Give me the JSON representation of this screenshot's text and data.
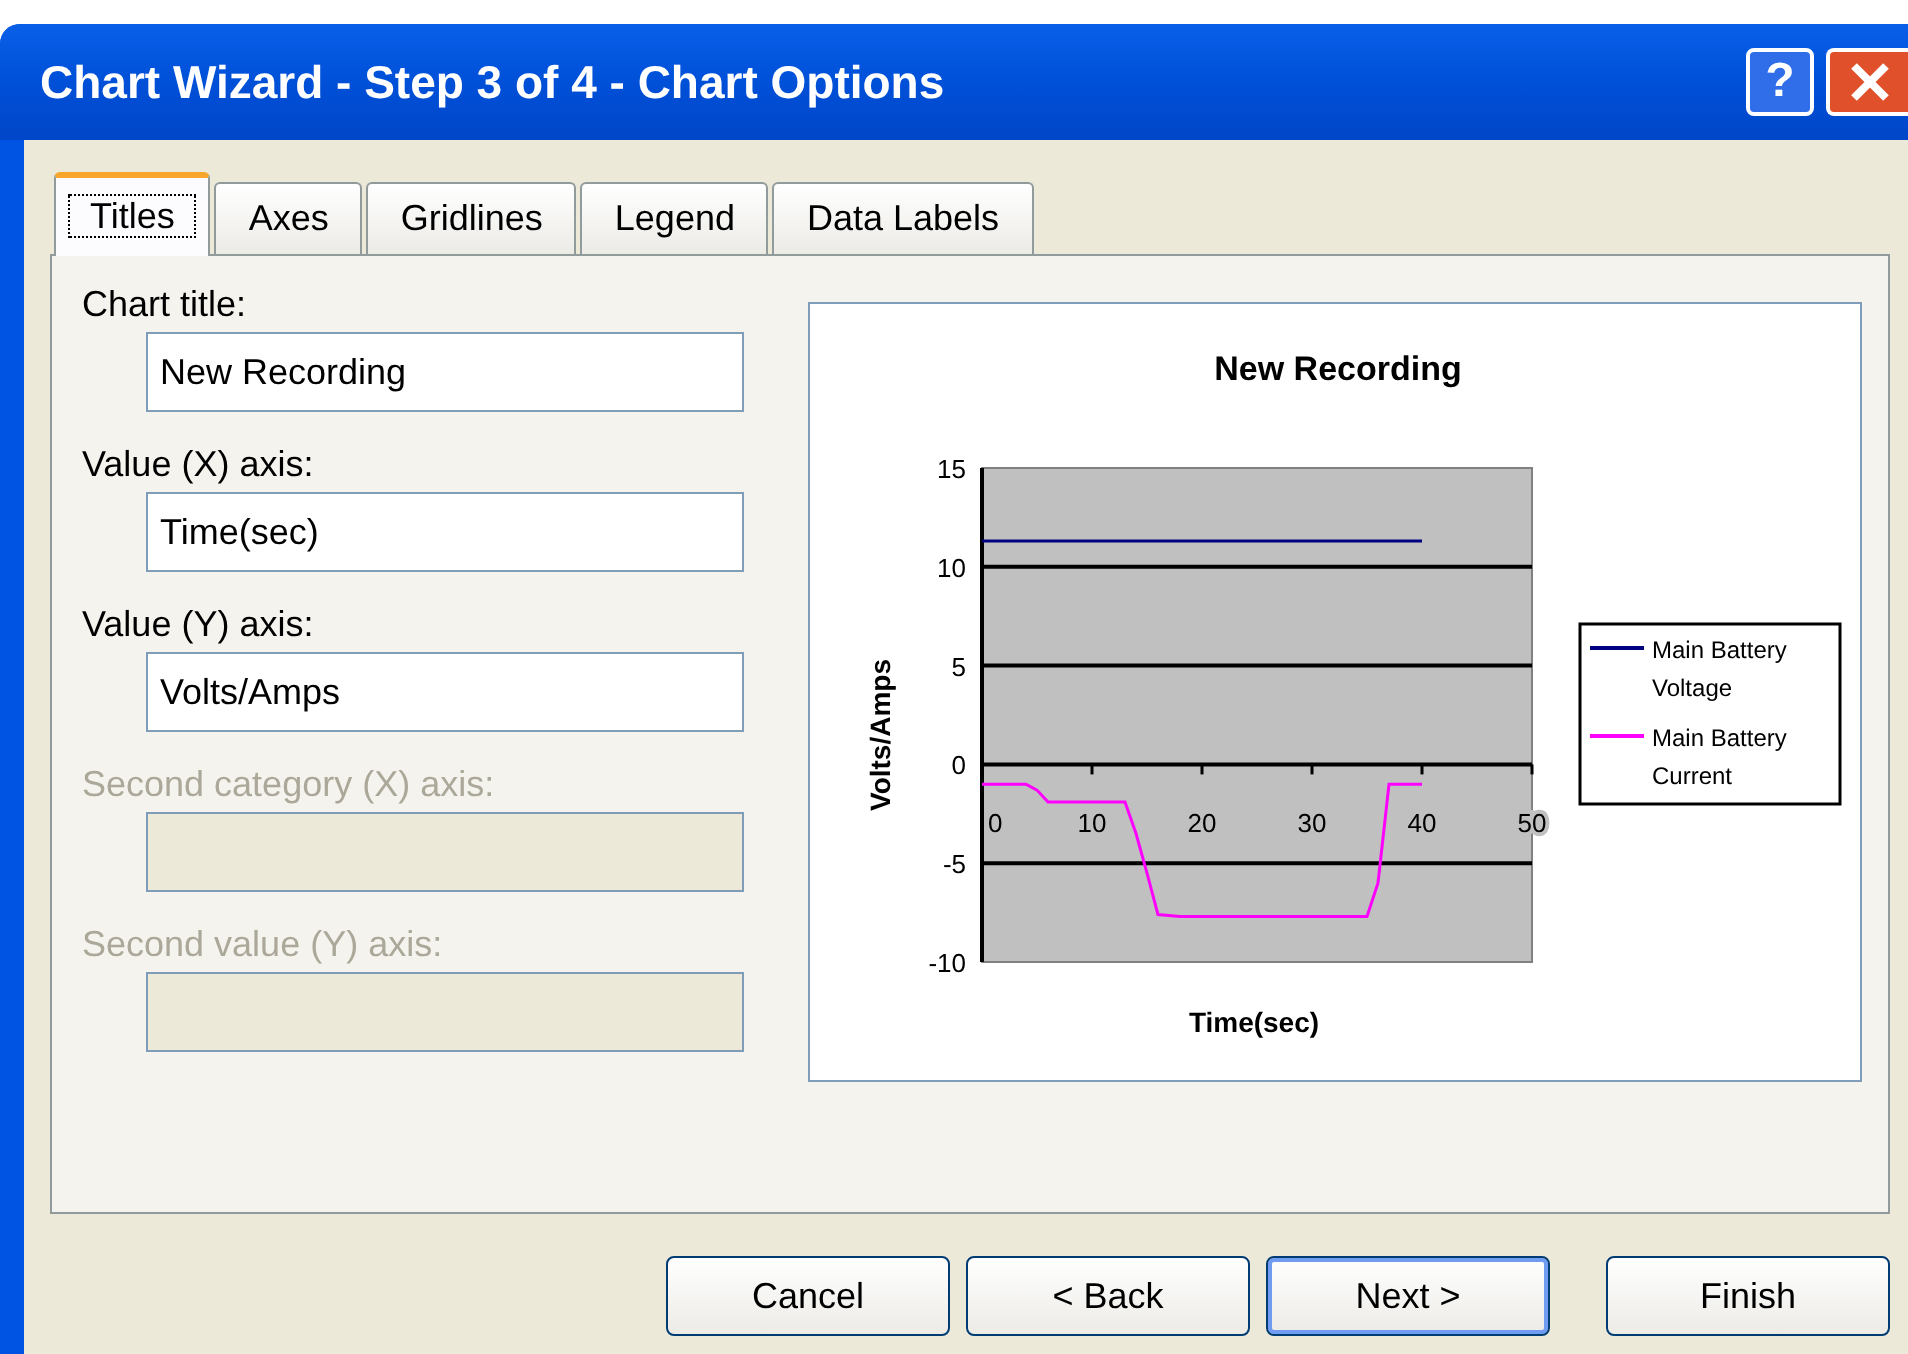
{
  "window": {
    "title": "Chart Wizard - Step 3 of 4 - Chart Options",
    "help_button": "?"
  },
  "tabs": [
    {
      "label": "Titles",
      "selected": true
    },
    {
      "label": "Axes",
      "selected": false
    },
    {
      "label": "Gridlines",
      "selected": false
    },
    {
      "label": "Legend",
      "selected": false
    },
    {
      "label": "Data Labels",
      "selected": false
    }
  ],
  "fields": [
    {
      "label": "Chart title:",
      "value": "New Recording",
      "disabled": false
    },
    {
      "label": "Value (X) axis:",
      "value": "Time(sec)",
      "disabled": false
    },
    {
      "label": "Value (Y) axis:",
      "value": "Volts/Amps",
      "disabled": false
    },
    {
      "label": "Second category (X) axis:",
      "disabled": true
    },
    {
      "label": "Second value (Y) axis:",
      "disabled": true
    }
  ],
  "preview": {
    "chart_data": {
      "type": "line",
      "title": "New Recording",
      "xlabel": "Time(sec)",
      "ylabel": "Volts/Amps",
      "x": [
        0,
        2,
        4,
        5,
        6,
        8,
        10,
        12,
        13,
        14,
        15,
        16,
        18,
        20,
        25,
        30,
        35,
        36,
        37,
        38,
        40
      ],
      "series": [
        {
          "name": "Main Battery Voltage",
          "color": "#000080",
          "values": [
            11.3,
            11.3,
            11.3,
            11.3,
            11.3,
            11.3,
            11.3,
            11.3,
            11.3,
            11.3,
            11.3,
            11.3,
            11.3,
            11.3,
            11.3,
            11.3,
            11.3,
            11.3,
            11.3,
            11.3,
            11.3
          ]
        },
        {
          "name": "Main Battery Current",
          "color": "#ff00ff",
          "values": [
            -1,
            -1,
            -1,
            -1.3,
            -1.9,
            -1.9,
            -1.9,
            -1.9,
            -1.9,
            -3.5,
            -5.5,
            -7.6,
            -7.7,
            -7.7,
            -7.7,
            -7.7,
            -7.7,
            -6,
            -1,
            -1,
            -1
          ]
        }
      ],
      "xlim": [
        0,
        50
      ],
      "ylim": [
        -10,
        15
      ],
      "xticks": [
        0,
        10,
        20,
        30,
        40,
        50
      ],
      "yticks": [
        -10,
        -5,
        0,
        5,
        10,
        15
      ],
      "grid": true,
      "legend": true
    }
  },
  "buttons": [
    {
      "label": "Cancel",
      "default": false
    },
    {
      "label": "< Back",
      "default": false
    },
    {
      "label": "Next >",
      "default": true
    },
    {
      "label": "Finish",
      "default": false
    }
  ]
}
